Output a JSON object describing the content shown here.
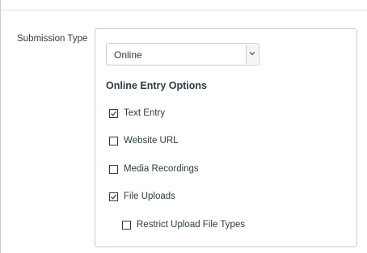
{
  "form": {
    "submission_type_label": "Submission Type",
    "select": {
      "value": "Online",
      "icon": "chevron-down-icon"
    },
    "section_title": "Online Entry Options",
    "options": [
      {
        "label": "Text Entry",
        "checked": true
      },
      {
        "label": "Website URL",
        "checked": false
      },
      {
        "label": "Media Recordings",
        "checked": false
      },
      {
        "label": "File Uploads",
        "checked": true
      },
      {
        "label": "Restrict Upload File Types",
        "checked": false
      }
    ]
  }
}
